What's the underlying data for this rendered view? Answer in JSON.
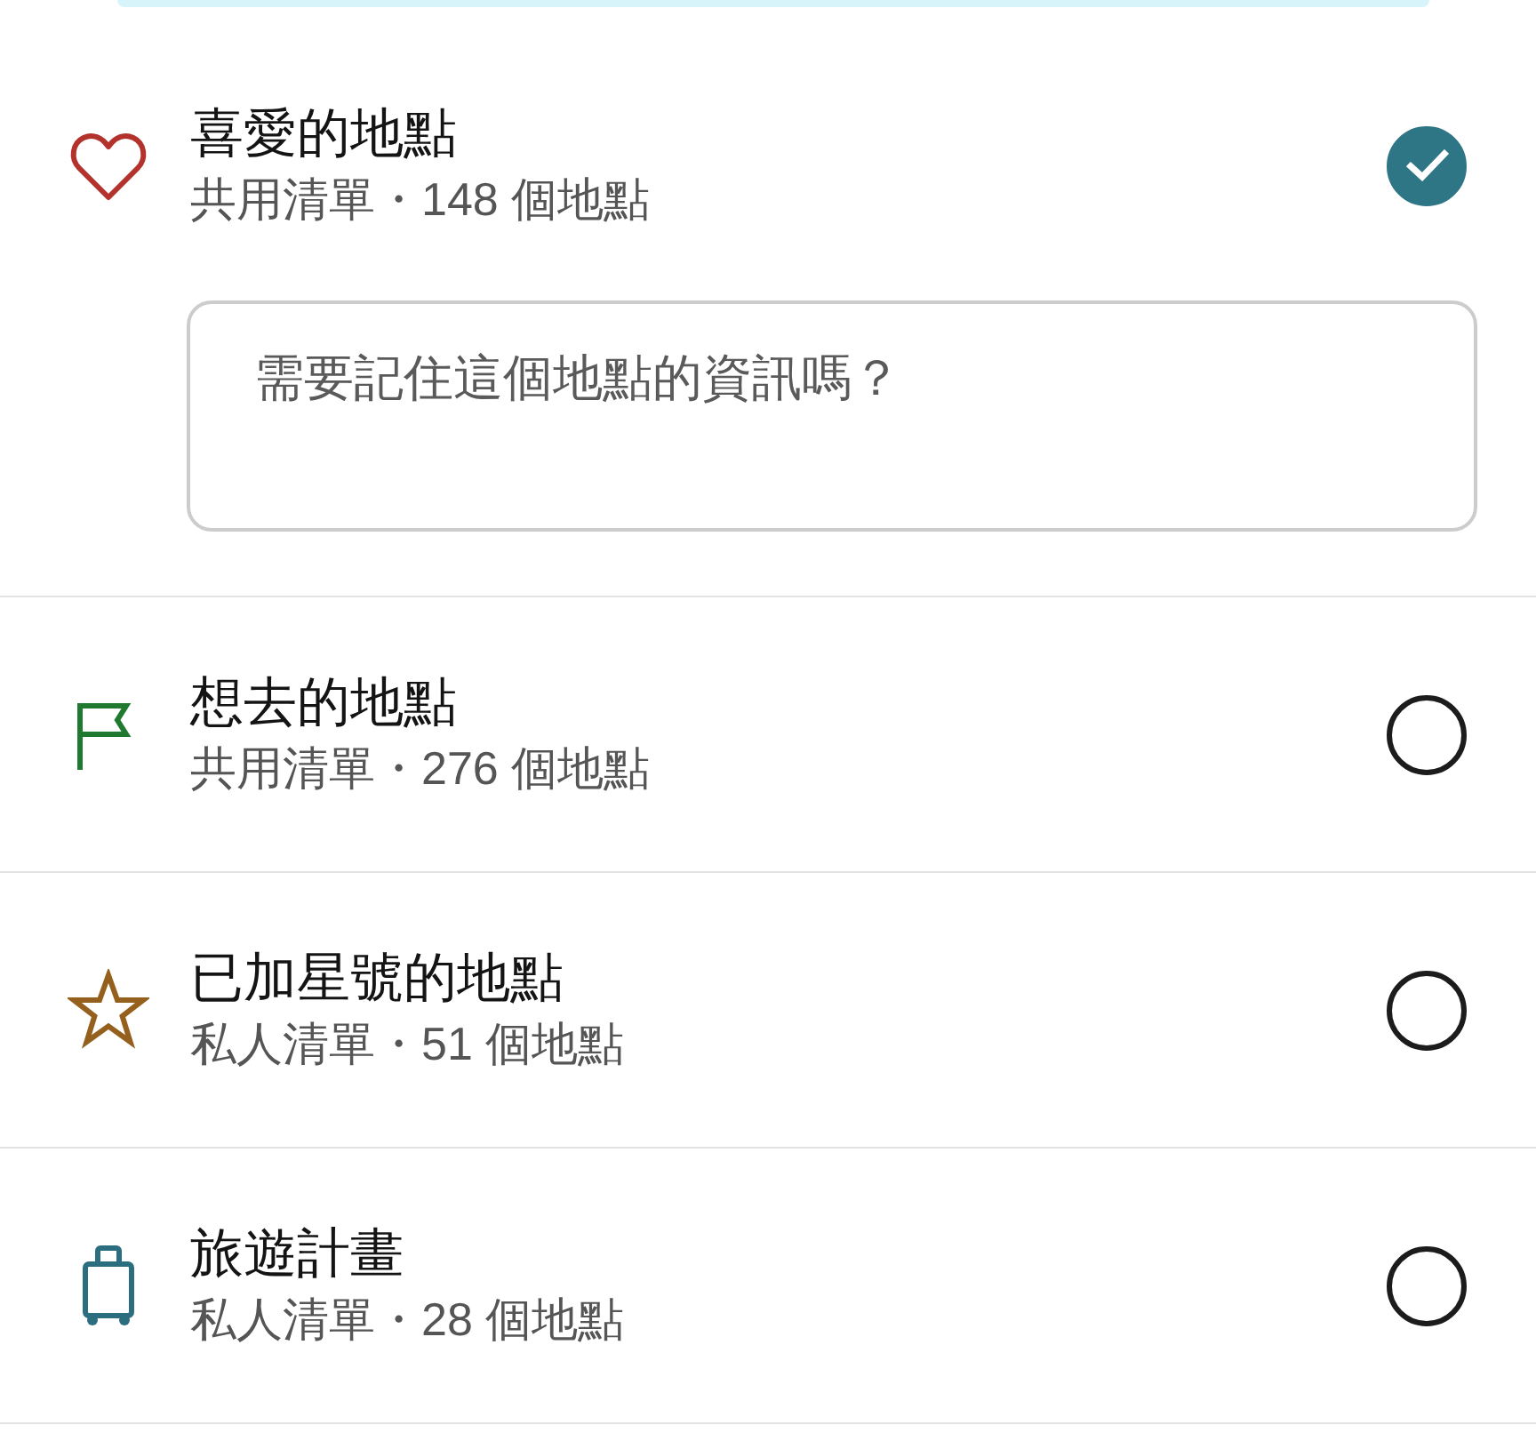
{
  "lists": [
    {
      "kind": "favorites",
      "color": "#b3322b",
      "title": "喜愛的地點",
      "subtitle": "共用清單・148 個地點",
      "selected": true,
      "note": {
        "placeholder": "需要記住這個地點的資訊嗎？"
      }
    },
    {
      "kind": "wishlist",
      "color": "#1f7a30",
      "title": "想去的地點",
      "subtitle": "共用清單・276 個地點",
      "selected": false
    },
    {
      "kind": "starred",
      "color": "#95601d",
      "title": "已加星號的地點",
      "subtitle": "私人清單・51 個地點",
      "selected": false
    },
    {
      "kind": "trip",
      "color": "#2b6e7f",
      "title": "旅遊計畫",
      "subtitle": "私人清單・28 個地點",
      "selected": false
    }
  ]
}
